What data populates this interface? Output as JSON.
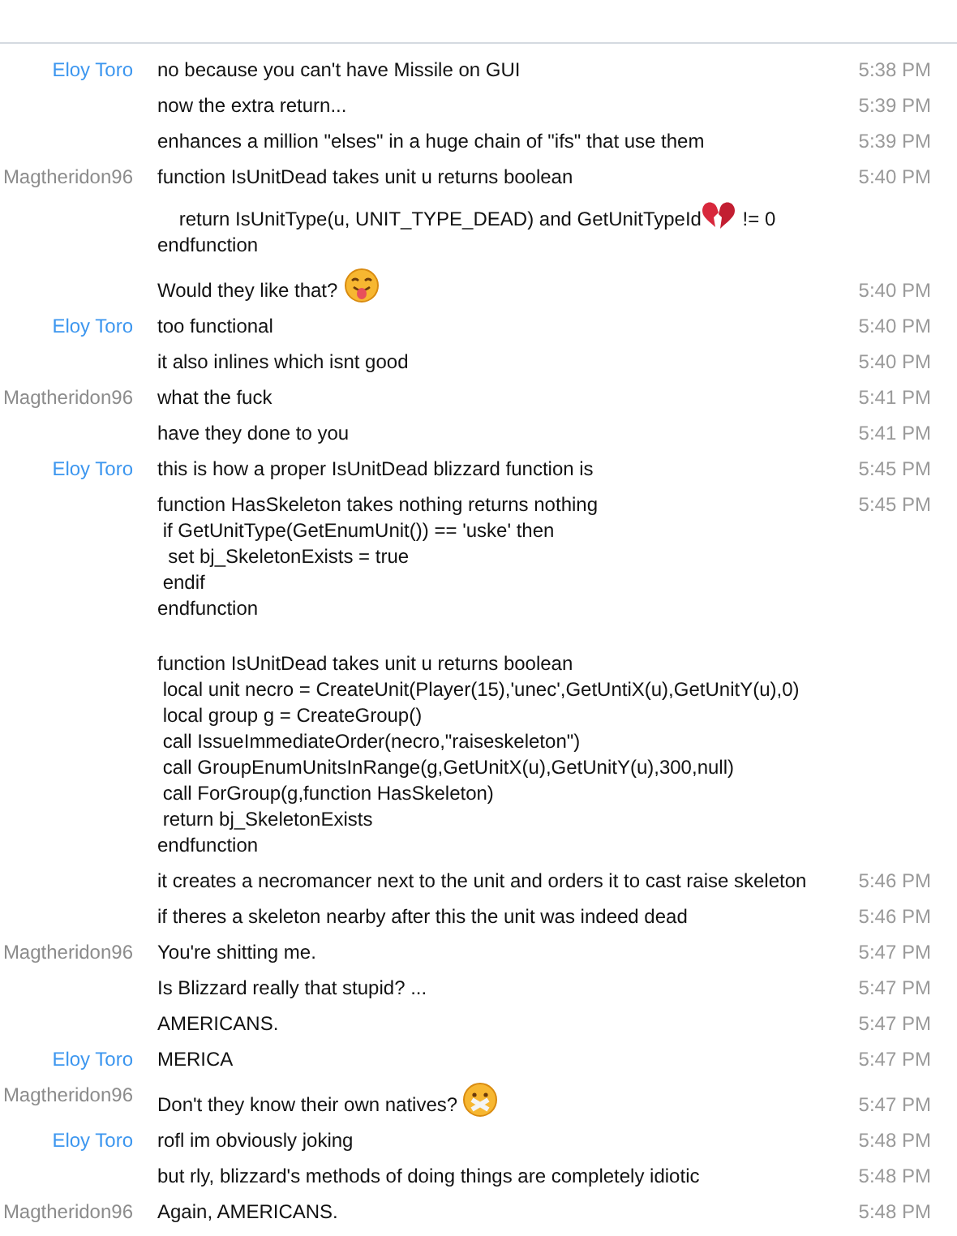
{
  "messages": [
    {
      "sender": "Eloy Toro",
      "color": "#3c96ef",
      "time": "5:38 PM",
      "lines": [
        [
          {
            "kind": "text",
            "text": "no because you can't have Missile on GUI"
          }
        ]
      ]
    },
    {
      "time": "5:39 PM",
      "lines": [
        [
          {
            "kind": "text",
            "text": "now the extra return..."
          }
        ]
      ]
    },
    {
      "time": "5:39 PM",
      "lines": [
        [
          {
            "kind": "text",
            "text": "enhances a million \"elses\" in a huge chain of \"ifs\" that use them"
          }
        ]
      ]
    },
    {
      "sender": "Magtheridon96",
      "color": "#8c8c8c",
      "time": "5:40 PM",
      "lines": [
        [
          {
            "kind": "text",
            "text": "function IsUnitDead takes unit u returns boolean"
          }
        ]
      ]
    },
    {
      "lines": [
        [
          {
            "kind": "text",
            "text": "    return IsUnitType(u, UNIT_TYPE_DEAD) and GetUnitTypeId"
          },
          {
            "kind": "heart"
          },
          {
            "kind": "text",
            "text": " != 0"
          }
        ],
        [
          {
            "kind": "text",
            "text": "endfunction"
          }
        ]
      ]
    },
    {
      "time": "5:40 PM",
      "lines": [
        [
          {
            "kind": "text",
            "text": "Would they like that? "
          },
          {
            "kind": "tongue"
          }
        ]
      ]
    },
    {
      "sender": "Eloy Toro",
      "color": "#3c96ef",
      "time": "5:40 PM",
      "lines": [
        [
          {
            "kind": "text",
            "text": "too functional"
          }
        ]
      ]
    },
    {
      "time": "5:40 PM",
      "lines": [
        [
          {
            "kind": "text",
            "text": "it also inlines which isnt good"
          }
        ]
      ]
    },
    {
      "sender": "Magtheridon96",
      "color": "#8c8c8c",
      "time": "5:41 PM",
      "lines": [
        [
          {
            "kind": "text",
            "text": "what the fuck"
          }
        ]
      ]
    },
    {
      "time": "5:41 PM",
      "lines": [
        [
          {
            "kind": "text",
            "text": "have they done to you"
          }
        ]
      ]
    },
    {
      "sender": "Eloy Toro",
      "color": "#3c96ef",
      "time": "5:45 PM",
      "lines": [
        [
          {
            "kind": "text",
            "text": "this is how a proper IsUnitDead blizzard function is"
          }
        ]
      ]
    },
    {
      "time": "5:45 PM",
      "lines": [
        [
          {
            "kind": "text",
            "text": "function HasSkeleton takes nothing returns nothing"
          }
        ],
        [
          {
            "kind": "text",
            "text": " if GetUnitType(GetEnumUnit()) == 'uske' then"
          }
        ],
        [
          {
            "kind": "text",
            "text": "  set bj_SkeletonExists = true"
          }
        ],
        [
          {
            "kind": "text",
            "text": " endif"
          }
        ],
        [
          {
            "kind": "text",
            "text": "endfunction"
          }
        ]
      ]
    },
    {
      "lines": [
        [
          {
            "kind": "text",
            "text": "function IsUnitDead takes unit u returns boolean"
          }
        ],
        [
          {
            "kind": "text",
            "text": " local unit necro = CreateUnit(Player(15),'unec',GetUntiX(u),GetUnitY(u),0)"
          }
        ],
        [
          {
            "kind": "text",
            "text": " local group g = CreateGroup()"
          }
        ],
        [
          {
            "kind": "text",
            "text": " call IssueImmediateOrder(necro,\"raiseskeleton\")"
          }
        ],
        [
          {
            "kind": "text",
            "text": " call GroupEnumUnitsInRange(g,GetUnitX(u),GetUnitY(u),300,null)"
          }
        ],
        [
          {
            "kind": "text",
            "text": " call ForGroup(g,function HasSkeleton)"
          }
        ],
        [
          {
            "kind": "text",
            "text": " return bj_SkeletonExists"
          }
        ],
        [
          {
            "kind": "text",
            "text": "endfunction"
          }
        ]
      ]
    },
    {
      "time": "5:46 PM",
      "lines": [
        [
          {
            "kind": "text",
            "text": "it creates a necromancer next to the unit and orders it to cast raise skeleton"
          }
        ]
      ]
    },
    {
      "time": "5:46 PM",
      "lines": [
        [
          {
            "kind": "text",
            "text": "if theres a skeleton nearby after this the unit was indeed dead"
          }
        ]
      ]
    },
    {
      "sender": "Magtheridon96",
      "color": "#8c8c8c",
      "time": "5:47 PM",
      "lines": [
        [
          {
            "kind": "text",
            "text": "You're shitting me."
          }
        ]
      ]
    },
    {
      "time": "5:47 PM",
      "lines": [
        [
          {
            "kind": "text",
            "text": "Is Blizzard really that stupid? ..."
          }
        ]
      ]
    },
    {
      "time": "5:47 PM",
      "lines": [
        [
          {
            "kind": "text",
            "text": "AMERICANS."
          }
        ]
      ]
    },
    {
      "sender": "Eloy Toro",
      "color": "#3c96ef",
      "time": "5:47 PM",
      "lines": [
        [
          {
            "kind": "text",
            "text": "MERICA"
          }
        ]
      ]
    },
    {
      "sender": "Magtheridon96",
      "color": "#8c8c8c",
      "time": "5:47 PM",
      "lines": [
        [
          {
            "kind": "text",
            "text": "Don't they know their own natives? "
          },
          {
            "kind": "sealed"
          }
        ]
      ]
    },
    {
      "sender": "Eloy Toro",
      "color": "#3c96ef",
      "time": "5:48 PM",
      "lines": [
        [
          {
            "kind": "text",
            "text": "rofl im obviously joking"
          }
        ]
      ]
    },
    {
      "time": "5:48 PM",
      "lines": [
        [
          {
            "kind": "text",
            "text": "but rly, blizzard's methods of doing things are completely idiotic"
          }
        ]
      ]
    },
    {
      "sender": "Magtheridon96",
      "color": "#8c8c8c",
      "time": "5:48 PM",
      "lines": [
        [
          {
            "kind": "text",
            "text": "Again, AMERICANS."
          }
        ]
      ]
    }
  ]
}
